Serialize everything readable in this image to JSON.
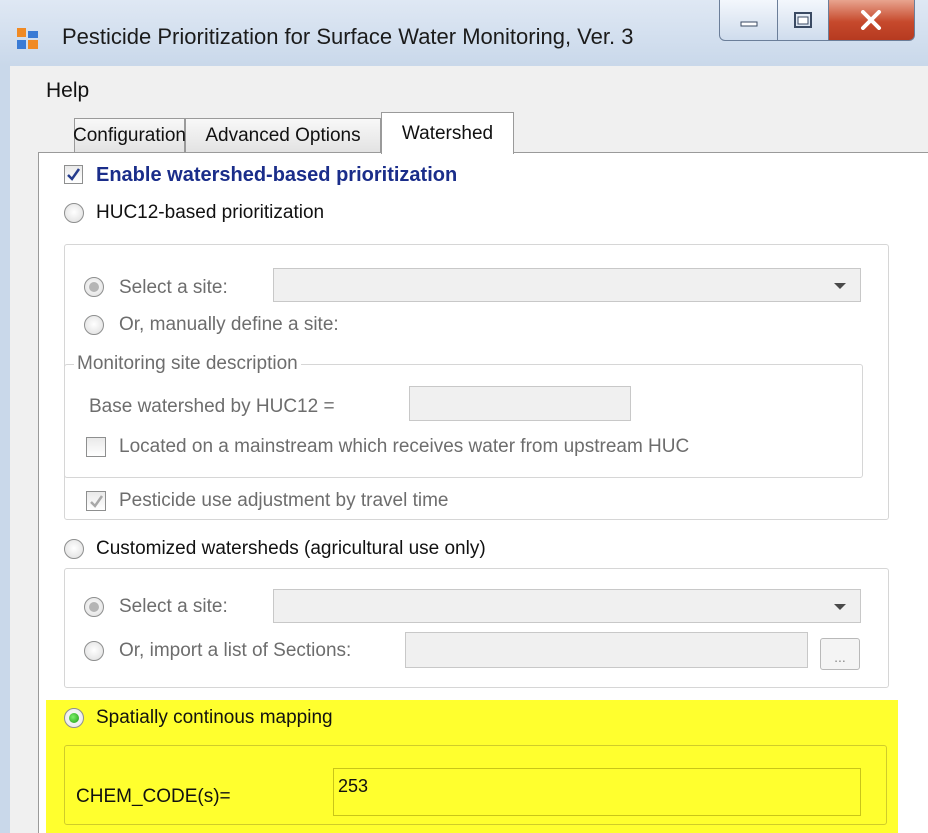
{
  "window": {
    "title": "Pesticide Prioritization for Surface Water Monitoring, Ver. 3",
    "controls": [
      "minimize",
      "maximize",
      "close"
    ]
  },
  "menu": {
    "help": "Help"
  },
  "tabs": [
    {
      "label": "Configuration",
      "active": false
    },
    {
      "label": "Advanced Options",
      "active": false
    },
    {
      "label": "Watershed",
      "active": true
    }
  ],
  "watershed": {
    "enable_label": "Enable watershed-based prioritization",
    "enable_checked": true,
    "huc12": {
      "label": "HUC12-based prioritization",
      "select_site_label": "Select a site:",
      "select_site_value": "",
      "manual_label": "Or, manually define a site:",
      "group_title": "Monitoring site description",
      "base_label": "Base watershed by HUC12 =",
      "base_value": "",
      "mainstream_label": "Located on a mainstream which receives water from upstream HUC",
      "travel_label": "Pesticide use adjustment by travel time",
      "travel_checked": true
    },
    "custom": {
      "label": "Customized watersheds (agricultural use only)",
      "select_site_label": "Select a site:",
      "select_site_value": "",
      "import_label": "Or, import a list of Sections:",
      "import_value": "",
      "browse_label": "..."
    },
    "spatial": {
      "label": "Spatially continous mapping",
      "selected": true,
      "chem_label": "CHEM_CODE(s)=",
      "chem_value": "253"
    }
  },
  "colors": {
    "highlight": "#FFFF2E",
    "enable_text": "#1A2D8A",
    "radio_selected": "#1C9A10"
  }
}
